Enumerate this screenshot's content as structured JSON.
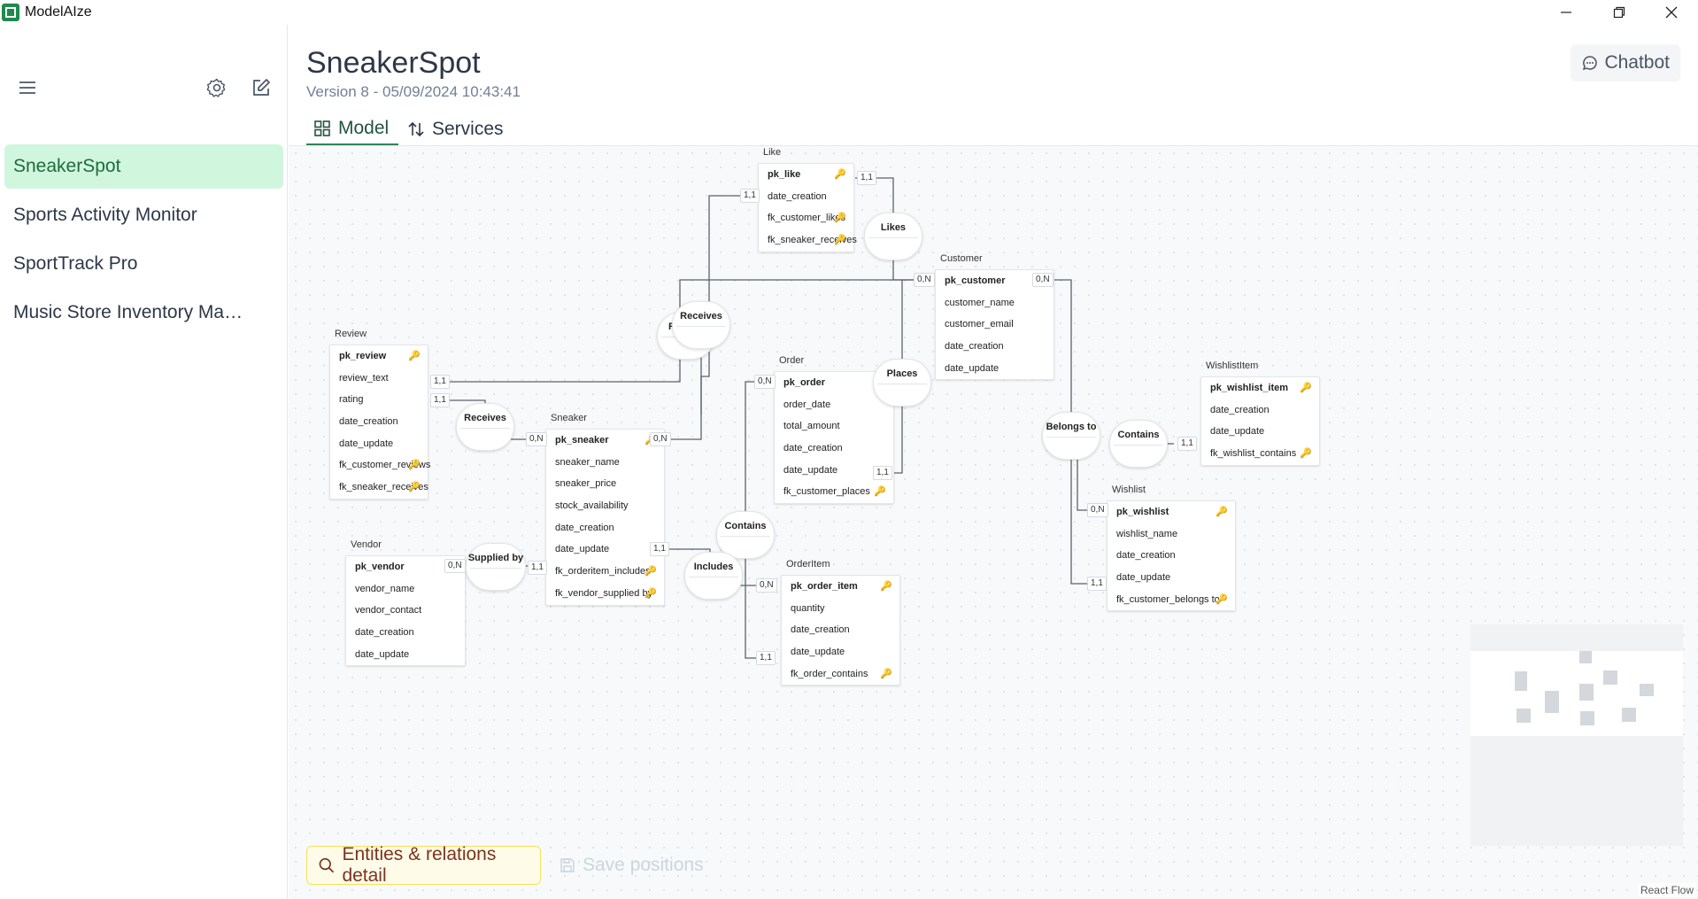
{
  "app": {
    "title": "ModelAIze"
  },
  "sidebar": {
    "projects": [
      {
        "label": "SneakerSpot",
        "active": true
      },
      {
        "label": "Sports Activity Monitor",
        "active": false
      },
      {
        "label": "SportTrack Pro",
        "active": false
      },
      {
        "label": "Music Store Inventory Ma…",
        "active": false
      }
    ]
  },
  "header": {
    "title": "SneakerSpot",
    "version": "Version 8 - 05/09/2024 10:43:41",
    "chatbot_label": "Chatbot",
    "tabs": [
      {
        "label": "Model",
        "active": true
      },
      {
        "label": "Services",
        "active": false
      }
    ]
  },
  "canvas": {
    "entities": {
      "like": {
        "name": "Like",
        "attrs": [
          "pk_like",
          "date_creation",
          "fk_customer_likes",
          "fk_sneaker_receives"
        ]
      },
      "review": {
        "name": "Review",
        "attrs": [
          "pk_review",
          "review_text",
          "rating",
          "date_creation",
          "date_update",
          "fk_customer_reviews",
          "fk_sneaker_receives"
        ]
      },
      "customer": {
        "name": "Customer",
        "attrs": [
          "pk_customer",
          "customer_name",
          "customer_email",
          "date_creation",
          "date_update"
        ]
      },
      "order": {
        "name": "Order",
        "attrs": [
          "pk_order",
          "order_date",
          "total_amount",
          "date_creation",
          "date_update",
          "fk_customer_places"
        ]
      },
      "sneaker": {
        "name": "Sneaker",
        "attrs": [
          "pk_sneaker",
          "sneaker_name",
          "sneaker_price",
          "stock_availability",
          "date_creation",
          "date_update",
          "fk_orderitem_includes",
          "fk_vendor_supplied by"
        ]
      },
      "wishlistitem": {
        "name": "WishlistItem",
        "attrs": [
          "pk_wishlist_item",
          "date_creation",
          "date_update",
          "fk_wishlist_contains"
        ]
      },
      "vendor": {
        "name": "Vendor",
        "attrs": [
          "pk_vendor",
          "vendor_name",
          "vendor_contact",
          "date_creation",
          "date_update"
        ]
      },
      "orderitem": {
        "name": "OrderItem",
        "attrs": [
          "pk_order_item",
          "quantity",
          "date_creation",
          "date_update",
          "fk_order_contains"
        ]
      },
      "wishlist": {
        "name": "Wishlist",
        "attrs": [
          "pk_wishlist",
          "wishlist_name",
          "date_creation",
          "date_update",
          "fk_customer_belongs to"
        ]
      }
    },
    "relations": {
      "likes": "Likes",
      "receives_top": "Receives",
      "reviews": "Rev",
      "receives_mid": "Receives",
      "places": "Places",
      "belongs_to": "Belongs to",
      "contains_wish": "Contains",
      "contains_order": "Contains",
      "includes": "Includes",
      "supplied_by": "Supplied by"
    },
    "cardinalities": {
      "like_sneaker": "1,1",
      "like_customer": "1,1",
      "customer_left": "0,N",
      "customer_right": "0,N",
      "review_customer": "1,1",
      "review_sneaker": "1,1",
      "sneaker_receives": "0,N",
      "sneaker_right": "0,N",
      "order_left": "0,N",
      "order_customer": "1,1",
      "wishitem_contains": "1,1",
      "wishlist_pk": "0,N",
      "wishlist_fk": "1,1",
      "vendor_pk": "0,N",
      "sneaker_supplied": "1,1",
      "sneaker_includes": "1,1",
      "orderitem_pk": "0,N",
      "orderitem_fk": "1,1"
    }
  },
  "actions": {
    "detail_label": "Entities & relations detail",
    "save_label": "Save positions"
  },
  "footer": {
    "attribution": "React Flow"
  }
}
